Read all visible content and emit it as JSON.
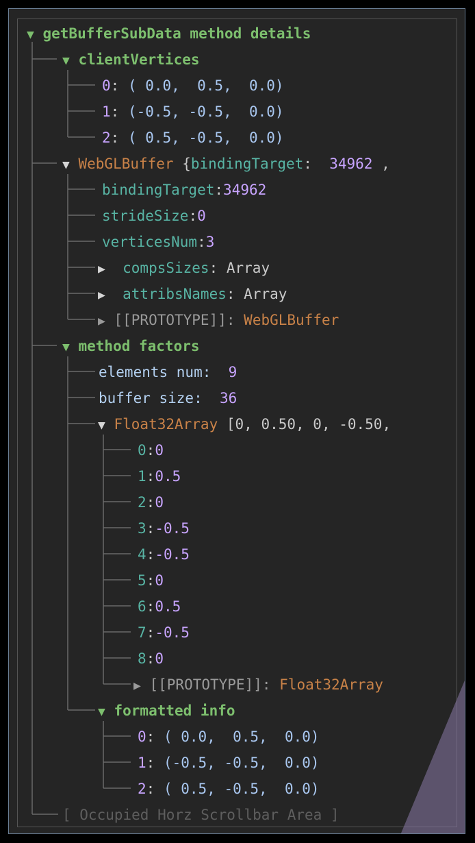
{
  "root": {
    "toggle": "▼",
    "title": "getBufferSubData method details"
  },
  "clientVertices": {
    "toggle": "▼",
    "label": "clientVertices",
    "items": [
      {
        "index": "0",
        "value": "( 0.0,  0.5,  0.0)"
      },
      {
        "index": "1",
        "value": "(-0.5, -0.5,  0.0)"
      },
      {
        "index": "2",
        "value": "( 0.5, -0.5,  0.0)"
      }
    ]
  },
  "webglBuffer": {
    "toggle": "▼",
    "label": "WebGLBuffer",
    "preview_open": "{",
    "preview_key": "bindingTarget",
    "preview_value": "34962",
    "preview_tail": ",",
    "props": [
      {
        "key": "bindingTarget",
        "value": "34962"
      },
      {
        "key": "strideSize",
        "value": "0"
      },
      {
        "key": "verticesNum",
        "value": "3"
      }
    ],
    "collapsed": [
      {
        "toggle": "▶",
        "key": "compsSizes",
        "value": "Array"
      },
      {
        "toggle": "▶",
        "key": "attribsNames",
        "value": "Array"
      }
    ],
    "prototype": {
      "toggle": "▶",
      "label": "[[PROTOTYPE]]:",
      "value": "WebGLBuffer"
    }
  },
  "methodFactors": {
    "toggle": "▼",
    "label": "method factors",
    "elements_label": "elements num:",
    "elements_value": "9",
    "buffer_label": "buffer size:",
    "buffer_value": "36",
    "float32": {
      "toggle": "▼",
      "label": "Float32Array",
      "preview": "[0, 0.50, 0, -0.50,",
      "items": [
        {
          "index": "0",
          "value": "0"
        },
        {
          "index": "1",
          "value": "0.5"
        },
        {
          "index": "2",
          "value": "0"
        },
        {
          "index": "3",
          "value": "-0.5"
        },
        {
          "index": "4",
          "value": "-0.5"
        },
        {
          "index": "5",
          "value": "0"
        },
        {
          "index": "6",
          "value": "0.5"
        },
        {
          "index": "7",
          "value": "-0.5"
        },
        {
          "index": "8",
          "value": "0"
        }
      ],
      "prototype": {
        "toggle": "▶",
        "label": "[[PROTOTYPE]]:",
        "value": "Float32Array"
      }
    },
    "formatted": {
      "toggle": "▼",
      "label": "formatted info",
      "items": [
        {
          "index": "0",
          "value": "( 0.0,  0.5,  0.0)"
        },
        {
          "index": "1",
          "value": "(-0.5, -0.5,  0.0)"
        },
        {
          "index": "2",
          "value": "( 0.5, -0.5,  0.0)"
        }
      ]
    }
  },
  "scrollbar": {
    "label": "[ Occupied Horz Scrollbar Area ]"
  },
  "colors": {
    "background": "#252525",
    "group": "#7dbf6e",
    "key": "#58b4a4",
    "number": "#c8a4ff",
    "class": "#c98248",
    "frame_border": "#6b7f96",
    "overlay": "#8a7aa8"
  }
}
